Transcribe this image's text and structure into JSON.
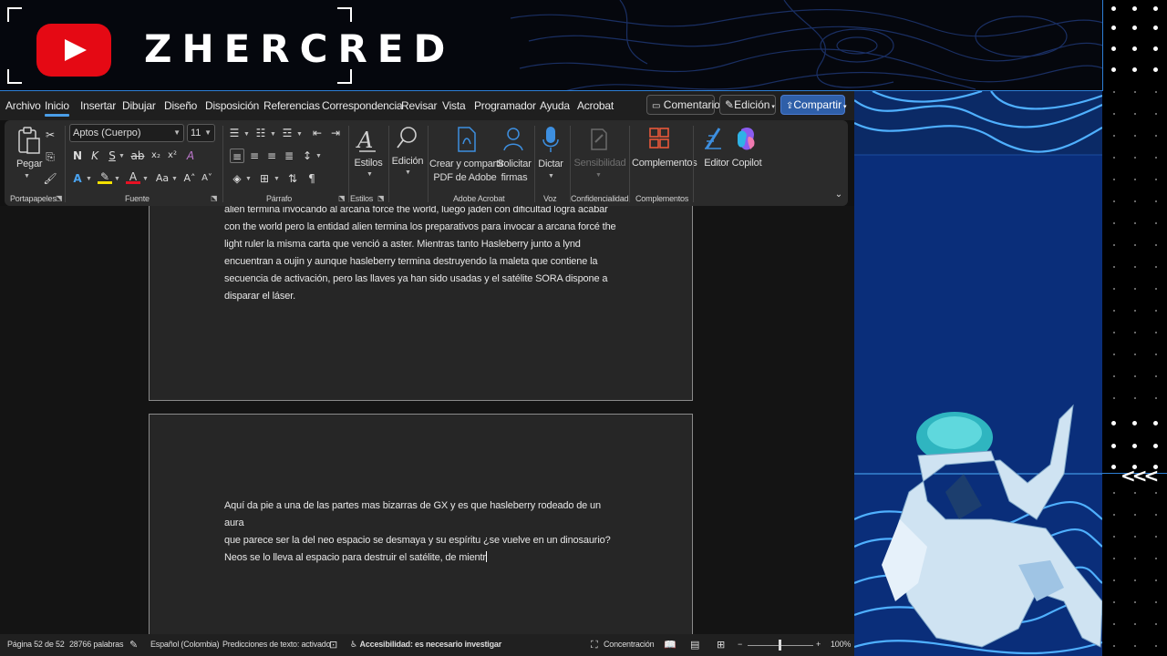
{
  "overlay": {
    "channel_name": "ZHERCRED",
    "logo": "youtube-logo",
    "side_chevrons": "<<<"
  },
  "menu": {
    "tabs": [
      "Archivo",
      "Inicio",
      "Insertar",
      "Dibujar",
      "Diseño",
      "Disposición",
      "Referencias",
      "Correspondencia",
      "Revisar",
      "Vista",
      "Programador",
      "Ayuda",
      "Acrobat"
    ],
    "active_tab": "Inicio",
    "comments_label": "Comentarios",
    "editing_label": "Edición",
    "share_label": "Compartir"
  },
  "ribbon": {
    "paste_label": "Pegar",
    "font_name": "Aptos (Cuerpo)",
    "font_size": "11",
    "styles_label": "Estilos",
    "editing_label": "Edición",
    "adobe_create_label_1": "Crear y compartir",
    "adobe_create_label_2": "PDF de Adobe",
    "request_sign_label_1": "Solicitar",
    "request_sign_label_2": "firmas",
    "dictate_label": "Dictar",
    "sensitivity_label": "Sensibilidad",
    "addins_label": "Complementos",
    "editor_label": "Editor",
    "copilot_label": "Copilot",
    "groups": {
      "clipboard": "Portapapeles",
      "font": "Fuente",
      "paragraph": "Párrafo",
      "styles": "Estilos",
      "adobe": "Adobe Acrobat",
      "voice": "Voz",
      "confidentiality": "Confidencialidad",
      "addins": "Complementos"
    }
  },
  "document": {
    "page1_lines": [
      "alien termina invocando al arcana force the world, luego jaden con dificultad logra acabar",
      "con the world pero la entidad alien termina los preparativos para invocar a arcana forcé the",
      "light ruler la misma carta que venció a aster. Mientras tanto Hasleberry junto a lynd",
      "encuentran a oujin y aunque hasleberry termina destruyendo la maleta que contiene la",
      "secuencia de activación, pero las llaves ya han sido usadas y el satélite SORA dispone a",
      "disparar el láser."
    ],
    "page2_lines": [
      "Aquí da pie a una de las partes mas bizarras de GX y es que hasleberry rodeado de un aura",
      "que parece ser la del neo espacio se desmaya y su espíritu ¿se vuelve en un dinosaurio?",
      "Neos se lo lleva al espacio para destruir el satélite, de mientr"
    ]
  },
  "status": {
    "page": "Página 52 de 52",
    "words": "28766 palabras",
    "language": "Español (Colombia)",
    "predictions": "Predicciones de texto: activado",
    "accessibility": "Accesibilidad: es necesario investigar",
    "focus": "Concentración",
    "zoom": "100%",
    "zoom_level": 1.0
  }
}
